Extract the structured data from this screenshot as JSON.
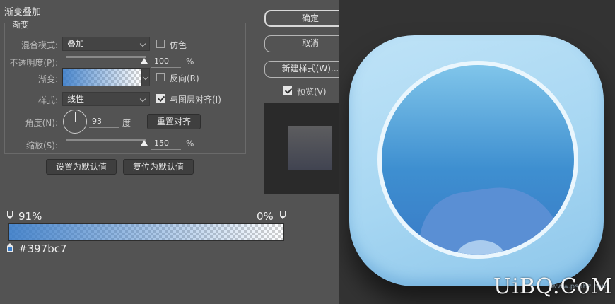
{
  "dialog": {
    "section_title": "渐变叠加",
    "group_label": "渐变",
    "blend_mode": {
      "label": "混合模式:",
      "value": "叠加"
    },
    "dither": {
      "label": "仿色",
      "checked": false
    },
    "opacity": {
      "label": "不透明度(P):",
      "value": "100",
      "unit": "%",
      "percent": 100
    },
    "gradient": {
      "label": "渐变:"
    },
    "reverse": {
      "label": "反向(R)",
      "checked": false
    },
    "style": {
      "label": "样式:",
      "value": "线性"
    },
    "align_with_layer": {
      "label": "与图层对齐(I)",
      "checked": true
    },
    "angle": {
      "label": "角度(N):",
      "value": "93",
      "unit": "度"
    },
    "reset_align_button": "重置对齐",
    "scale": {
      "label": "缩放(S):",
      "value": "150",
      "unit": "%",
      "percent": 100
    },
    "make_default_button": "设置为默认值",
    "reset_default_button": "复位为默认值",
    "ok_button": "确定",
    "cancel_button": "取消",
    "new_style_button": "新建样式(W)...",
    "preview": {
      "label": "预览(V)",
      "checked": true
    }
  },
  "gradient_editor": {
    "left_opacity": "91%",
    "right_opacity": "0%",
    "color_hex": "#397bc7",
    "start_color": "#397bc7"
  },
  "artwork": {
    "watermark": "UiBQ.CoM",
    "watermark_sub": "www.psahz.com",
    "colors": {
      "frame_light": "#bfe3f7",
      "disc_top": "#80c5ea",
      "disc_bottom": "#397bc7",
      "background": "#333333"
    }
  }
}
